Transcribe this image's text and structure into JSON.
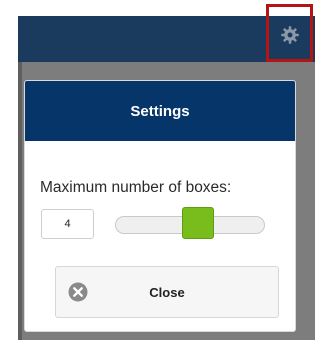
{
  "dialog": {
    "title": "Settings",
    "field_label": "Maximum number of boxes:",
    "max_boxes_value": "4",
    "slider_fraction": 0.55,
    "close_label": "Close"
  },
  "colors": {
    "header": "#1b3b5e",
    "modal_header": "#06356a",
    "slider_thumb": "#79bd1c",
    "highlight": "#b41414"
  },
  "icons": {
    "settings": "gear-icon",
    "close": "close-circle-icon"
  }
}
